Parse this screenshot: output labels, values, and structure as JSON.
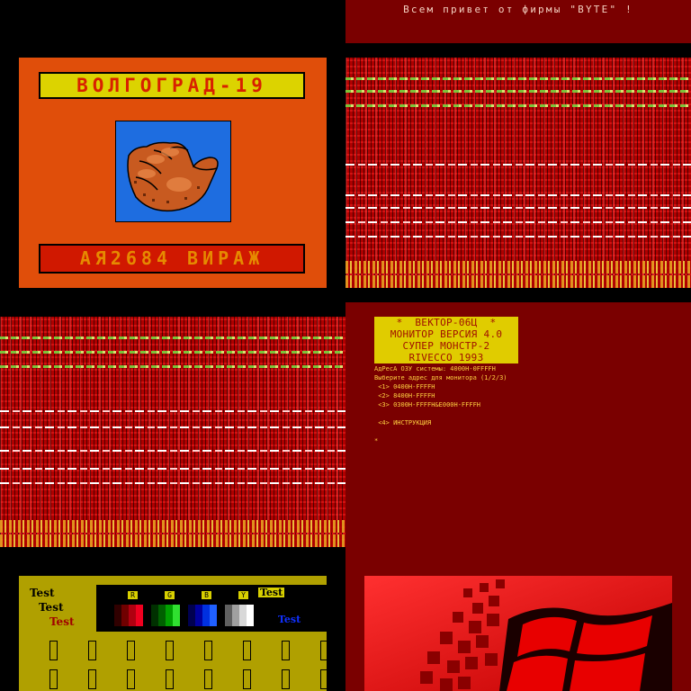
{
  "top_banner": {
    "text": "Всем привет от фирмы \"BYTE\" !"
  },
  "volgograd": {
    "title": "ВОЛГОГРАД-19",
    "footer": "АЯ2684 ВИРАЖ",
    "picture": "pointing-fist-illustration"
  },
  "monitor": {
    "header_lines": [
      "*  ВЕКТОР-06Ц  *",
      "МОНИТОР ВЕРСИЯ 4.0",
      "СУПЕР МОНСТР-2",
      "RIVECCO 1993"
    ],
    "lines": [
      "АдРесА ОЗУ системы: 4000Н-0FFFFН",
      "Выберите адрес для монитора (1/2/3)",
      " <1> 0400Н-FFFFН",
      " <2> 8400Н-FFFFН",
      " <3> 0300Н-FFFFН&E000Н-FFFFН",
      "",
      " <4> ИНСТРУКЦИЯ",
      "",
      "*"
    ]
  },
  "test_screen": {
    "labels": [
      "Test",
      "Test",
      "Test"
    ],
    "swatch_labels": [
      "R",
      "G",
      "B",
      "Y"
    ],
    "panel_label_top": "Test",
    "panel_label_bottom": "Test",
    "colors": {
      "R": [
        "#300000",
        "#700000",
        "#b00010",
        "#f00020"
      ],
      "G": [
        "#003000",
        "#006000",
        "#00a000",
        "#30e030"
      ],
      "B": [
        "#000050",
        "#0000a0",
        "#0030e0",
        "#2060ff"
      ],
      "Y": [
        "#606060",
        "#a0a0a0",
        "#d8d8d8",
        "#ffffff"
      ]
    }
  },
  "colors": {
    "dark_red": "#7a0000",
    "orange": "#e04e0a",
    "yellow": "#dcd300",
    "noise_red": "#b00000"
  }
}
